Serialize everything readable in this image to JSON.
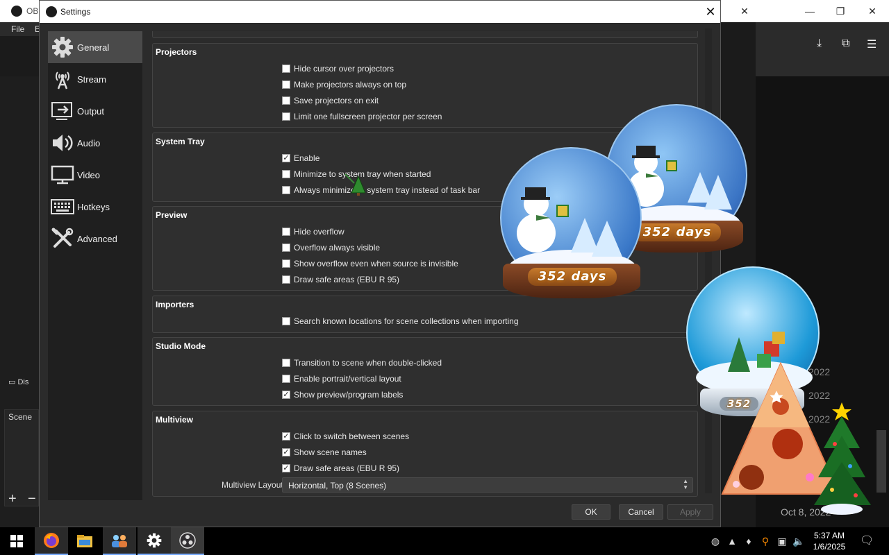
{
  "background_window": {
    "title": "OBS",
    "menu": {
      "file": "File",
      "edit": "E"
    },
    "display_label": "Dis",
    "scenes_label": "Scene",
    "add_symbol": "+",
    "remove_symbol": "−",
    "date_fragment": "Oct 8, 2022",
    "year_labels": [
      "2022",
      "2022",
      "2022"
    ]
  },
  "dialog": {
    "title": "Settings",
    "close_symbol": "✕",
    "sidebar": [
      {
        "label": "General",
        "icon": "gear-icon",
        "active": true
      },
      {
        "label": "Stream",
        "icon": "antenna-icon",
        "active": false
      },
      {
        "label": "Output",
        "icon": "output-icon",
        "active": false
      },
      {
        "label": "Audio",
        "icon": "speaker-icon",
        "active": false
      },
      {
        "label": "Video",
        "icon": "monitor-icon",
        "active": false
      },
      {
        "label": "Hotkeys",
        "icon": "keyboard-icon",
        "active": false
      },
      {
        "label": "Advanced",
        "icon": "tools-icon",
        "active": false
      }
    ],
    "groups": {
      "projectors": {
        "title": "Projectors",
        "options": [
          {
            "label": "Hide cursor over projectors",
            "checked": false
          },
          {
            "label": "Make projectors always on top",
            "checked": false
          },
          {
            "label": "Save projectors on exit",
            "checked": false
          },
          {
            "label": "Limit one fullscreen projector per screen",
            "checked": false
          }
        ]
      },
      "system_tray": {
        "title": "System Tray",
        "options": [
          {
            "label": "Enable",
            "checked": true
          },
          {
            "label": "Minimize to system tray when started",
            "checked": false
          },
          {
            "label": "Always minimize to system tray instead of task bar",
            "checked": false
          }
        ]
      },
      "preview": {
        "title": "Preview",
        "options": [
          {
            "label": "Hide overflow",
            "checked": false
          },
          {
            "label": "Overflow always visible",
            "checked": false
          },
          {
            "label": "Show overflow even when source is invisible",
            "checked": false
          },
          {
            "label": "Draw safe areas (EBU R 95)",
            "checked": false
          }
        ]
      },
      "importers": {
        "title": "Importers",
        "options": [
          {
            "label": "Search known locations for scene collections when importing",
            "checked": false
          }
        ]
      },
      "studio_mode": {
        "title": "Studio Mode",
        "options": [
          {
            "label": "Transition to scene when double-clicked",
            "checked": false
          },
          {
            "label": "Enable portrait/vertical layout",
            "checked": false
          },
          {
            "label": "Show preview/program labels",
            "checked": true
          }
        ]
      },
      "multiview": {
        "title": "Multiview",
        "options": [
          {
            "label": "Click to switch between scenes",
            "checked": true
          },
          {
            "label": "Show scene names",
            "checked": true
          },
          {
            "label": "Draw safe areas (EBU R 95)",
            "checked": true
          }
        ],
        "layout_label": "Multiview Layout",
        "layout_value": "Horizontal, Top (8 Scenes)"
      }
    },
    "buttons": {
      "ok": "OK",
      "cancel": "Cancel",
      "apply": "Apply"
    }
  },
  "overlay": {
    "countdown_1": "352 days",
    "countdown_2": "352 days",
    "countdown_3": "352"
  },
  "taskbar": {
    "apps": [
      "windows-start-icon",
      "firefox-icon",
      "file-explorer-icon",
      "people-app-icon",
      "settings-gear-icon",
      "obs-studio-icon"
    ],
    "tray": [
      "obs-tray-icon",
      "app-tray-icon",
      "drop-icon",
      "search-key-icon",
      "network-icon",
      "volume-icon"
    ],
    "time": "5:37 AM",
    "date": "1/6/2025",
    "notification_icon": "notification-icon"
  },
  "colors": {
    "dialog_bg": "#2b2b2b",
    "sidebar_bg": "#1f1f1f",
    "sidebar_active": "#4a4a4a",
    "group_bg": "#2f2f2f",
    "checkbox_bg": "#ffffff"
  }
}
